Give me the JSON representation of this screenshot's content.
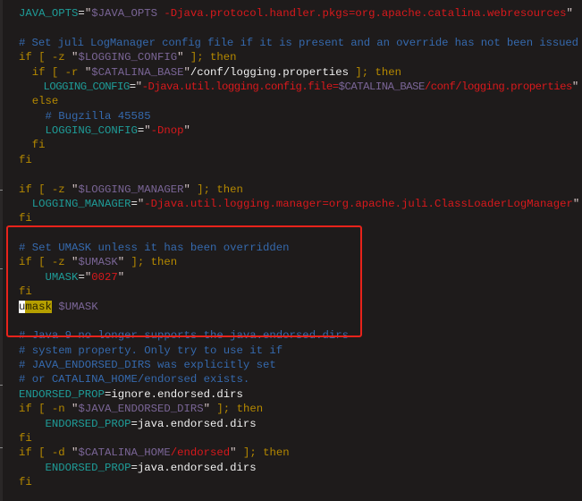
{
  "editor": {
    "highlight_box_color": "#e8231b",
    "cursor_word": "umask",
    "lines": [
      [
        [
          "v",
          "JAVA_OPTS"
        ],
        [
          "p",
          "="
        ],
        [
          "q",
          "\""
        ],
        [
          "d",
          "$JAVA_OPTS"
        ],
        [
          "s",
          " -Djava.protocol.handler.pkgs=org.apache.catalina.webresources"
        ],
        [
          "q",
          "\""
        ]
      ],
      [],
      [
        [
          "c",
          "# Set juli LogManager config file if it is present and an override has not been issued"
        ]
      ],
      [
        [
          "k",
          "if [ -z "
        ],
        [
          "q",
          "\""
        ],
        [
          "d",
          "$LOGGING_CONFIG"
        ],
        [
          "q",
          "\""
        ],
        [
          "k",
          " ]; then"
        ]
      ],
      [
        [
          "p",
          "  "
        ],
        [
          "k",
          "if [ -r "
        ],
        [
          "q",
          "\""
        ],
        [
          "d",
          "$CATALINA_BASE"
        ],
        [
          "q",
          "\""
        ],
        [
          "p",
          "/conf/logging.properties"
        ],
        [
          "k",
          " ]; then"
        ]
      ],
      [
        [
          "p",
          "    "
        ],
        [
          "v",
          "LOGGING_CONFIG"
        ],
        [
          "p",
          "="
        ],
        [
          "q",
          "\""
        ],
        [
          "s",
          "-Djava.util.logging.config.file="
        ],
        [
          "d",
          "$CATALINA_BASE"
        ],
        [
          "s",
          "/conf/logging.properties"
        ],
        [
          "q",
          "\""
        ]
      ],
      [
        [
          "p",
          "  "
        ],
        [
          "k",
          "else"
        ]
      ],
      [
        [
          "p",
          "    "
        ],
        [
          "c",
          "# Bugzilla 45585"
        ]
      ],
      [
        [
          "p",
          "    "
        ],
        [
          "v",
          "LOGGING_CONFIG"
        ],
        [
          "p",
          "="
        ],
        [
          "q",
          "\""
        ],
        [
          "s",
          "-Dnop"
        ],
        [
          "q",
          "\""
        ]
      ],
      [
        [
          "p",
          "  "
        ],
        [
          "k",
          "fi"
        ]
      ],
      [
        [
          "k",
          "fi"
        ]
      ],
      [],
      [
        [
          "k",
          "if [ -z "
        ],
        [
          "q",
          "\""
        ],
        [
          "d",
          "$LOGGING_MANAGER"
        ],
        [
          "q",
          "\""
        ],
        [
          "k",
          " ]; then"
        ]
      ],
      [
        [
          "p",
          "  "
        ],
        [
          "v",
          "LOGGING_MANAGER"
        ],
        [
          "p",
          "="
        ],
        [
          "q",
          "\""
        ],
        [
          "s",
          "-Djava.util.logging.manager=org.apache.juli.ClassLoaderLogManager"
        ],
        [
          "q",
          "\""
        ]
      ],
      [
        [
          "k",
          "fi"
        ]
      ],
      [],
      [
        [
          "c",
          "# Set UMASK unless it has been overridden"
        ]
      ],
      [
        [
          "k",
          "if [ -z "
        ],
        [
          "q",
          "\""
        ],
        [
          "d",
          "$UMASK"
        ],
        [
          "q",
          "\""
        ],
        [
          "k",
          " ]; then"
        ]
      ],
      [
        [
          "p",
          "    "
        ],
        [
          "v",
          "UMASK"
        ],
        [
          "p",
          "="
        ],
        [
          "q",
          "\""
        ],
        [
          "s",
          "0027"
        ],
        [
          "q",
          "\""
        ]
      ],
      [
        [
          "k",
          "fi"
        ]
      ],
      [
        [
          "cur",
          "u"
        ],
        [
          "hl",
          "mask"
        ],
        [
          "p",
          " "
        ],
        [
          "d",
          "$UMASK"
        ]
      ],
      [],
      [
        [
          "c",
          "# Java 9 no longer supports the java.endorsed.dirs"
        ]
      ],
      [
        [
          "c",
          "# system property. Only try to use it if"
        ]
      ],
      [
        [
          "c",
          "# JAVA_ENDORSED_DIRS was explicitly set"
        ]
      ],
      [
        [
          "c",
          "# or CATALINA_HOME/endorsed exists."
        ]
      ],
      [
        [
          "v",
          "ENDORSED_PROP"
        ],
        [
          "p",
          "=ignore.endorsed.dirs"
        ]
      ],
      [
        [
          "k",
          "if [ -n "
        ],
        [
          "q",
          "\""
        ],
        [
          "d",
          "$JAVA_ENDORSED_DIRS"
        ],
        [
          "q",
          "\""
        ],
        [
          "k",
          " ]; then"
        ]
      ],
      [
        [
          "p",
          "    "
        ],
        [
          "v",
          "ENDORSED_PROP"
        ],
        [
          "p",
          "=java.endorsed.dirs"
        ]
      ],
      [
        [
          "k",
          "fi"
        ]
      ],
      [
        [
          "k",
          "if [ -d "
        ],
        [
          "q",
          "\""
        ],
        [
          "d",
          "$CATALINA_HOME"
        ],
        [
          "s",
          "/endorsed"
        ],
        [
          "q",
          "\""
        ],
        [
          "k",
          " ]; then"
        ]
      ],
      [
        [
          "p",
          "    "
        ],
        [
          "v",
          "ENDORSED_PROP"
        ],
        [
          "p",
          "=java.endorsed.dirs"
        ]
      ],
      [
        [
          "k",
          "fi"
        ]
      ]
    ]
  }
}
